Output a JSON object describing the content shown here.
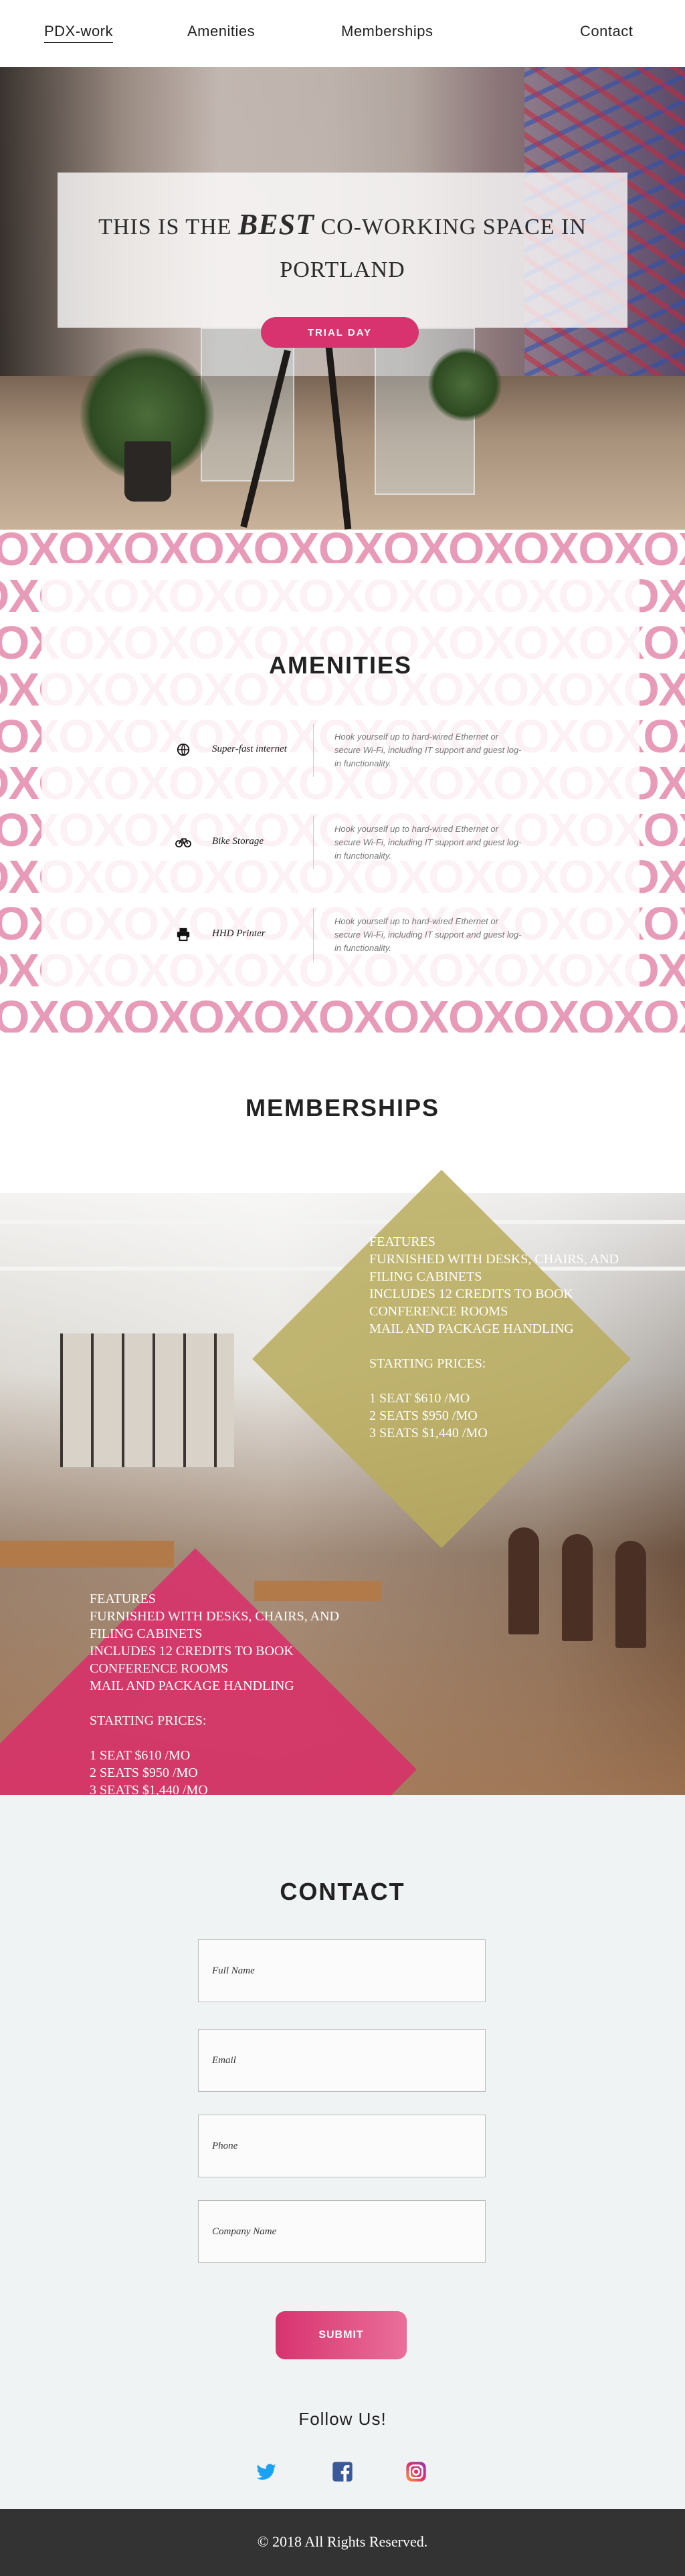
{
  "nav": {
    "items": [
      {
        "label": "PDX-work",
        "active": true
      },
      {
        "label": "Amenities"
      },
      {
        "label": "Memberships"
      },
      {
        "label": "Contact"
      }
    ]
  },
  "hero": {
    "title_before": "THIS IS THE ",
    "title_emphasis": "BEST",
    "title_after": " CO-WORKING SPACE IN PORTLAND",
    "button_label": "TRIAL DAY"
  },
  "amenities": {
    "title": "AMENITIES",
    "pattern_text": "OX",
    "items": [
      {
        "icon": "globe-icon",
        "name": "Super-fast internet",
        "description": "Hook yourself up to hard-wired Ethernet or secure Wi-Fi, including IT support and guest log-in functionality."
      },
      {
        "icon": "bike-icon",
        "name": "Bike Storage",
        "description": "Hook yourself up to hard-wired Ethernet or secure Wi-Fi, including IT support and guest log-in functionality."
      },
      {
        "icon": "printer-icon",
        "name": "HHD Printer",
        "description": "Hook yourself up to hard-wired Ethernet or secure Wi-Fi, including IT support and guest log-in functionality."
      }
    ]
  },
  "memberships": {
    "title": "MEMBERSHIPS",
    "plans": [
      {
        "color": "#b8ac5c",
        "features_heading": "FEATURES",
        "features": [
          "FURNISHED WITH DESKS, CHAIRS, AND",
          "FILING CABINETS",
          "INCLUDES 12 CREDITS TO BOOK",
          "CONFERENCE ROOMS",
          "MAIL AND PACKAGE HANDLING"
        ],
        "prices_heading": "STARTING PRICES:",
        "prices": [
          "1 SEAT $610 /MO",
          "2 SEATS $950 /MO",
          "3 SEATS $1,440 /MO"
        ]
      },
      {
        "color": "#dd2a6a",
        "features_heading": "FEATURES",
        "features": [
          "FURNISHED WITH DESKS, CHAIRS, AND",
          "FILING CABINETS",
          "INCLUDES 12 CREDITS TO BOOK",
          "CONFERENCE ROOMS",
          "MAIL AND PACKAGE HANDLING"
        ],
        "prices_heading": "STARTING PRICES:",
        "prices": [
          "1 SEAT $610 /MO",
          "2 SEATS $950 /MO",
          "3 SEATS $1,440 /MO"
        ]
      }
    ]
  },
  "contact": {
    "title": "CONTACT",
    "fields": [
      {
        "placeholder": "Full Name",
        "value": ""
      },
      {
        "placeholder": "Email",
        "value": ""
      },
      {
        "placeholder": "Phone",
        "value": ""
      },
      {
        "placeholder": "Company Name",
        "value": ""
      }
    ],
    "submit_label": "SUBMIT",
    "follow_label": "Follow Us!",
    "social": [
      {
        "icon": "twitter-icon",
        "color": "#1da1f2"
      },
      {
        "icon": "facebook-icon",
        "color": "#3b5998"
      },
      {
        "icon": "instagram-icon",
        "color": "#e1306c"
      }
    ]
  },
  "footer": {
    "copyright": "© 2018 All Rights Reserved."
  },
  "colors": {
    "accent": "#d8336e",
    "pattern_pink": "#e79bb8",
    "gold": "#b8ac5c",
    "footer_bg": "#333333",
    "contact_bg": "#f0f3f4"
  }
}
